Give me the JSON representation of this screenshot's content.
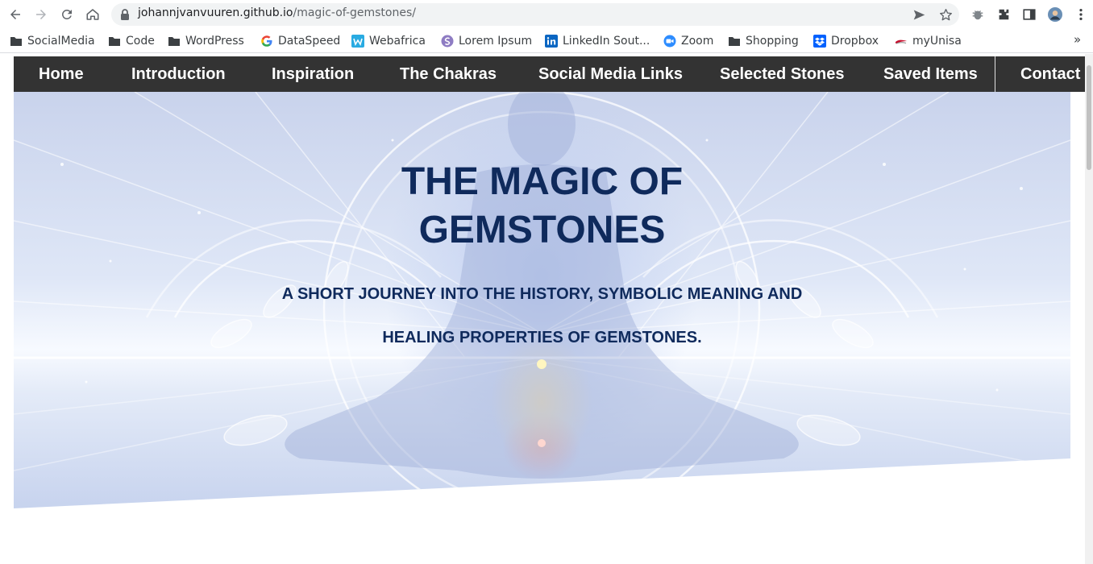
{
  "browser": {
    "url_domain": "johannjvanvuuren.github.io",
    "url_path": "/magic-of-gemstones/",
    "bookmarks": [
      {
        "label": "SocialMedia",
        "icon": "folder-icon"
      },
      {
        "label": "Code",
        "icon": "folder-icon"
      },
      {
        "label": "WordPress",
        "icon": "folder-icon"
      },
      {
        "label": "DataSpeed",
        "icon": "google-icon"
      },
      {
        "label": "Webafrica",
        "icon": "webafrica-icon"
      },
      {
        "label": "Lorem Ipsum",
        "icon": "lorem-ipsum-icon"
      },
      {
        "label": "LinkedIn Sout...",
        "icon": "linkedin-icon"
      },
      {
        "label": "Zoom",
        "icon": "zoom-icon"
      },
      {
        "label": "Shopping",
        "icon": "folder-icon"
      },
      {
        "label": "Dropbox",
        "icon": "dropbox-icon"
      },
      {
        "label": "myUnisa",
        "icon": "unisa-icon"
      }
    ],
    "bookmarks_overflow": "»"
  },
  "nav": {
    "items": [
      "Home",
      "Introduction",
      "Inspiration",
      "The Chakras",
      "Social Media Links",
      "Selected Stones",
      "Saved Items",
      "Contact"
    ],
    "bg_color": "#333333"
  },
  "hero": {
    "title_line1": "THE MAGIC OF",
    "title_line2": "GEMSTONES",
    "subtitle_line1": "A SHORT JOURNEY INTO THE HISTORY, SYMBOLIC MEANING AND",
    "subtitle_line2": "HEALING PROPERTIES OF GEMSTONES.",
    "text_color": "#0f2a5c"
  }
}
